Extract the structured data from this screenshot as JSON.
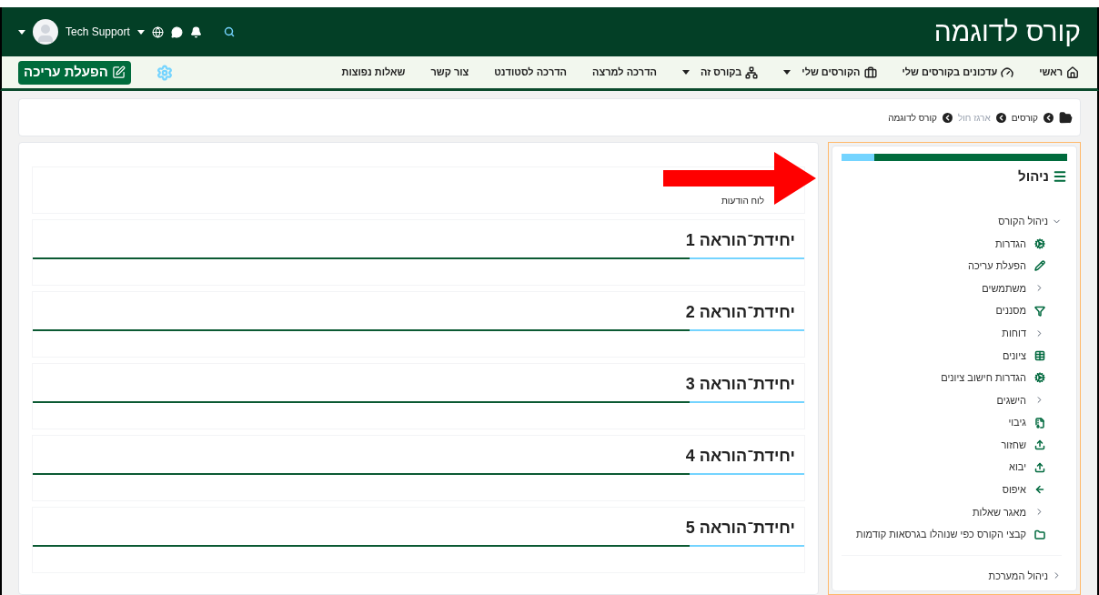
{
  "header": {
    "title": "קורס לדוגמה",
    "user_name": "Tech Support"
  },
  "nav": {
    "items": [
      {
        "label": "ראשי",
        "dropdown": false
      },
      {
        "label": "עדכונים בקורסים שלי",
        "dropdown": false
      },
      {
        "label": "הקורסים שלי",
        "dropdown": true
      },
      {
        "label": "בקורס זה",
        "dropdown": true
      },
      {
        "label": "הדרכה למרצה",
        "dropdown": false
      },
      {
        "label": "הדרכה לסטודנט",
        "dropdown": false
      },
      {
        "label": "צור קשר",
        "dropdown": false
      },
      {
        "label": "שאלות נפוצות",
        "dropdown": false
      }
    ],
    "edit_button": "הפעלת עריכה"
  },
  "breadcrumb": [
    {
      "label": "קורסים",
      "muted": false
    },
    {
      "label": "ארגז חול",
      "muted": true
    },
    {
      "label": "קורס לדוגמה",
      "muted": false
    }
  ],
  "main": {
    "announcements": "לוח הודעות",
    "sections": [
      "יחידת־הוראה 1",
      "יחידת־הוראה 2",
      "יחידת־הוראה 3",
      "יחידת־הוראה 4",
      "יחידת־הוראה 5"
    ]
  },
  "admin_block": {
    "title": "ניהול",
    "tree": [
      {
        "label": "ניהול הקורס",
        "expanded": true,
        "children": [
          {
            "label": "הגדרות",
            "kind": "link"
          },
          {
            "label": "הפעלת עריכה",
            "kind": "link"
          },
          {
            "label": "משתמשים",
            "kind": "branch"
          },
          {
            "label": "מסננים",
            "kind": "link"
          },
          {
            "label": "דוחות",
            "kind": "branch"
          },
          {
            "label": "ציונים",
            "kind": "link"
          },
          {
            "label": "הגדרות חישוב ציונים",
            "kind": "link"
          },
          {
            "label": "הישגים",
            "kind": "branch"
          },
          {
            "label": "גיבוי",
            "kind": "link"
          },
          {
            "label": "שחזור",
            "kind": "link"
          },
          {
            "label": "יבוא",
            "kind": "link"
          },
          {
            "label": "איפוס",
            "kind": "link"
          },
          {
            "label": "מאגר שאלות",
            "kind": "branch"
          },
          {
            "label": "קבצי הקורס כפי שנוהלו בגרסאות קודמות",
            "kind": "link"
          }
        ]
      },
      {
        "label": "ניהול המערכת",
        "expanded": false
      }
    ]
  }
}
